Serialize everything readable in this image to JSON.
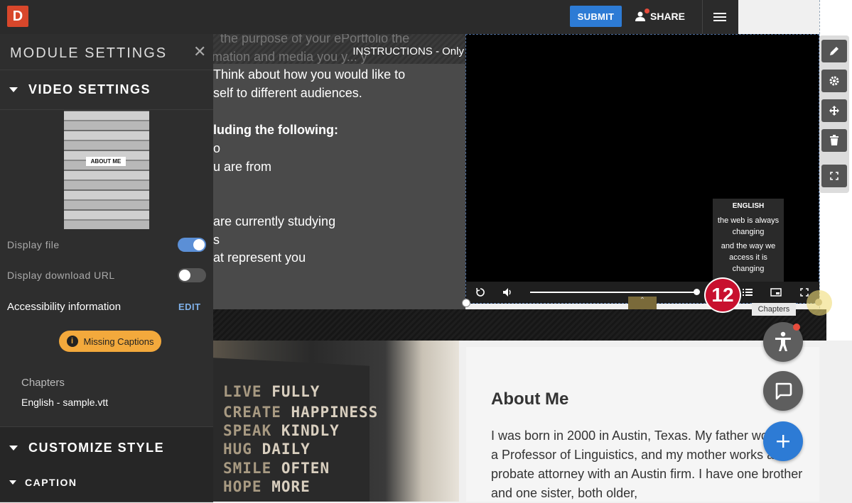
{
  "topbar": {
    "logo": "D",
    "submit_label": "SUBMIT",
    "share_label": "SHARE"
  },
  "panel": {
    "title": "MODULE SETTINGS",
    "video_settings_label": "VIDEO SETTINGS",
    "thumbnail_label": "ABOUT ME",
    "display_file_label": "Display file",
    "display_file_on": true,
    "display_download_label": "Display download URL",
    "display_download_on": false,
    "accessibility_label": "Accessibility information",
    "edit_label": "EDIT",
    "missing_captions_label": "Missing Captions",
    "chapters_label": "Chapters",
    "chapters_file": "English - sample.vtt",
    "customize_style_label": "CUSTOMIZE STYLE",
    "caption_label": "CAPTION"
  },
  "text_card": {
    "faded_line_1": "the purpose of your ePortfolio the",
    "faded_line_2": "rmation and media you y...  y",
    "instructions_label": "INSTRUCTIONS - Only",
    "lines": [
      "Think about how you would like to",
      "self to different audiences.",
      "",
      "luding the following:",
      "o",
      "u are from",
      "",
      "",
      "are currently studying",
      "s",
      "at represent you"
    ]
  },
  "video": {
    "caption_language": "ENGLISH",
    "caption_cue_1": "the web is always changing",
    "caption_cue_2": "and the way we access it is changing",
    "chapters_tooltip": "Chapters",
    "step_badge": "12"
  },
  "sign": {
    "lines": [
      {
        "a": "LIVE",
        "b": "FULLY"
      },
      {
        "a": "CREATE",
        "b": "HAPPINESS"
      },
      {
        "a": "SPEAK",
        "b": "KINDLY"
      },
      {
        "a": "HUG",
        "b": "DAILY"
      },
      {
        "a": "SMILE",
        "b": "OFTEN"
      },
      {
        "a": "HOPE",
        "b": "MORE"
      }
    ]
  },
  "about": {
    "title": "About Me",
    "body": "I was born in 2000 in Austin, Texas. My father works as a Professor of Linguistics, and my mother works as a probate attorney with an Austin firm. I have one brother and one sister, both older,"
  },
  "colors": {
    "accent": "#2d7bd5",
    "badge": "#c8102e",
    "warning": "#f3a93c",
    "logo": "#d8472b"
  },
  "icons": {
    "edit": "pencil-icon",
    "settings": "gear-icon",
    "move": "move-icon",
    "delete": "trash-icon",
    "fullscreen": "expand-icon"
  }
}
